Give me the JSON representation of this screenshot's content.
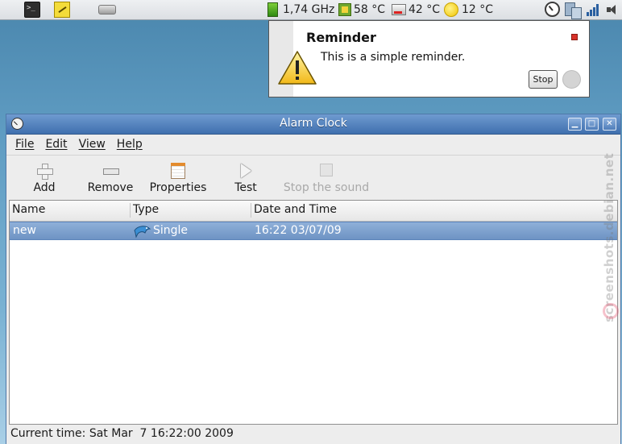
{
  "panel": {
    "launchers": [
      "terminal-icon",
      "notes-icon",
      "drive-icon"
    ],
    "cpu_freq": "1,74 GHz",
    "cpu_temp": "58 °C",
    "disk_temp": "42 °C",
    "weather_temp": "12 °C",
    "tray_icons": [
      "alarm-clock-icon",
      "network-icon",
      "signal-icon",
      "volume-icon"
    ]
  },
  "notification": {
    "title": "Reminder",
    "message": "This is a simple reminder.",
    "stop_label": "Stop",
    "icon": "warning-icon"
  },
  "window": {
    "title": "Alarm Clock",
    "menu": [
      "File",
      "Edit",
      "View",
      "Help"
    ],
    "toolbar": {
      "add": "Add",
      "remove": "Remove",
      "properties": "Properties",
      "test": "Test",
      "stop_sound": "Stop the sound"
    },
    "columns": [
      "Name",
      "Type",
      "Date and Time"
    ],
    "rows": [
      {
        "name": "new",
        "type": "Single",
        "datetime": "16:22 03/07/09"
      }
    ],
    "status": "Current time: Sat Mar  7 16:22:00 2009"
  },
  "watermark": "screenshots.debian.net",
  "colors": {
    "titlebar": "#4f7db9",
    "selection": "#7c9ecd",
    "desktop": "#5f9cc2"
  }
}
